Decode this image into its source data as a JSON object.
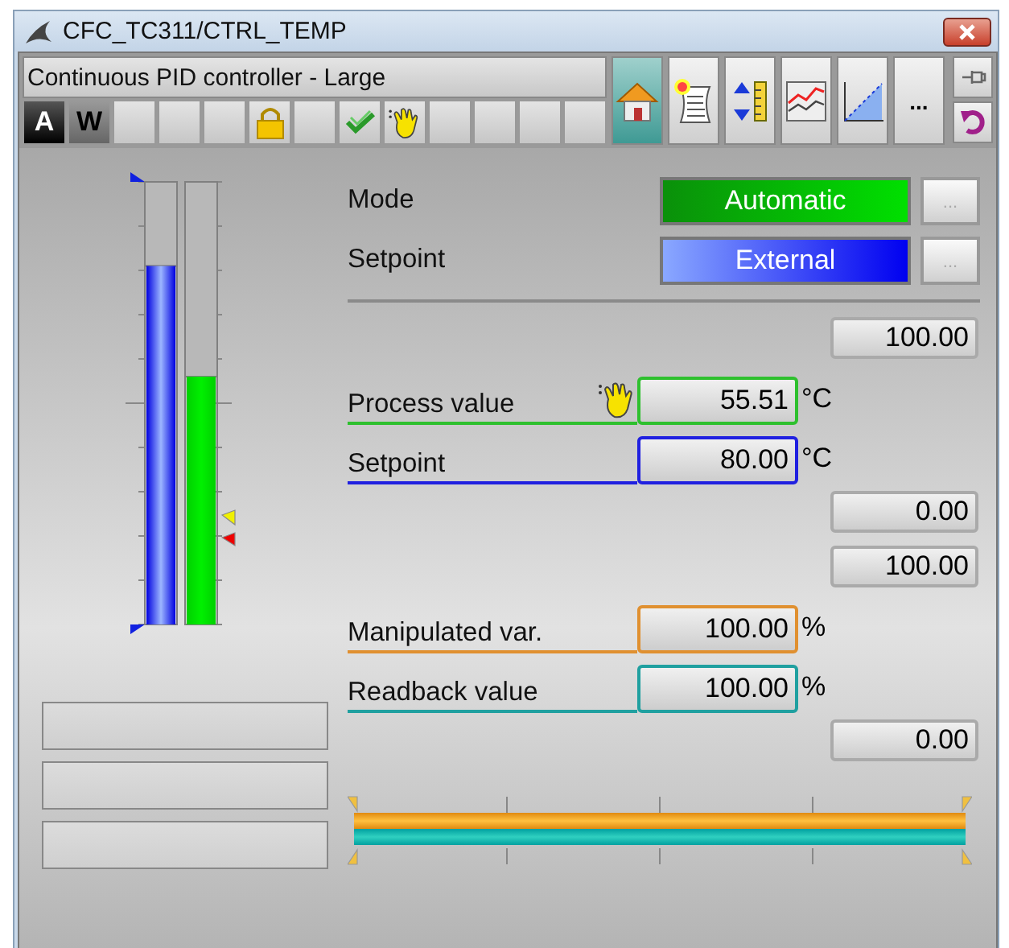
{
  "window": {
    "title": "CFC_TC311/CTRL_TEMP"
  },
  "header": {
    "title": "Continuous PID controller - Large",
    "status_buttons": [
      {
        "kind": "inverse",
        "label": "A"
      },
      {
        "kind": "shaded",
        "label": "W"
      },
      {
        "kind": "empty"
      },
      {
        "kind": "empty"
      },
      {
        "kind": "empty"
      },
      {
        "kind": "lock"
      },
      {
        "kind": "empty"
      },
      {
        "kind": "check"
      },
      {
        "kind": "hand"
      },
      {
        "kind": "empty"
      },
      {
        "kind": "empty"
      },
      {
        "kind": "empty"
      },
      {
        "kind": "empty"
      }
    ]
  },
  "views": [
    {
      "kind": "home",
      "selected": true
    },
    {
      "kind": "alarm",
      "selected": false
    },
    {
      "kind": "limits",
      "selected": false
    },
    {
      "kind": "trend",
      "selected": false
    },
    {
      "kind": "ramp",
      "selected": false
    },
    {
      "kind": "more",
      "label": "...",
      "selected": false
    }
  ],
  "bars": [
    {
      "kind": "setpoint",
      "level": 0.81
    },
    {
      "kind": "process",
      "level": 0.56
    }
  ],
  "mode": [
    {
      "label": "Mode",
      "value": "Automatic",
      "kind": "green",
      "button": "..."
    },
    {
      "label": "Setpoint",
      "value": "External",
      "kind": "blue",
      "button": "..."
    }
  ],
  "rows": [
    {
      "kind": "limit",
      "value": "100.00"
    },
    {
      "kind": "value",
      "label": "Process value",
      "value": "55.51",
      "unit": "°C",
      "color": "#2ec02e",
      "manual": true
    },
    {
      "kind": "value",
      "label": "Setpoint",
      "value": "80.00",
      "unit": "°C",
      "color": "#2020e0",
      "manual": false
    },
    {
      "kind": "limit",
      "value": "0.00"
    },
    {
      "kind": "limit",
      "value": "100.00"
    },
    {
      "kind": "value",
      "label": "Manipulated var.",
      "value": "100.00",
      "unit": "%",
      "color": "#e09030",
      "manual": false
    },
    {
      "kind": "value",
      "label": "Readback value",
      "value": "100.00",
      "unit": "%",
      "color": "#20a0a0",
      "manual": false
    },
    {
      "kind": "limit",
      "value": "0.00"
    }
  ],
  "output_bars": [
    {
      "kind": "output",
      "level": 1
    },
    {
      "kind": "readback",
      "level": 1
    }
  ]
}
